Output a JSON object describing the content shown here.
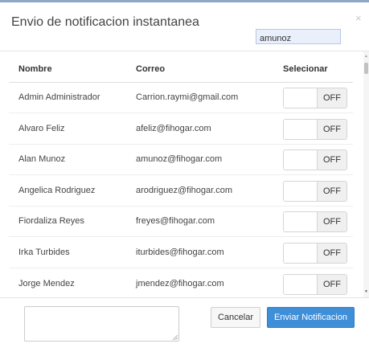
{
  "modal": {
    "title": "Envio de notificacion instantanea",
    "close_glyph": "×"
  },
  "search": {
    "value": "amunoz",
    "placeholder": ""
  },
  "table": {
    "headers": {
      "name": "Nombre",
      "email": "Correo",
      "select": "Selecionar"
    },
    "rows": [
      {
        "name": "Admin Administrador",
        "email": "Carrion.raymi@gmail.com",
        "toggle": "OFF"
      },
      {
        "name": "Alvaro Feliz",
        "email": "afeliz@fihogar.com",
        "toggle": "OFF"
      },
      {
        "name": "Alan Munoz",
        "email": "amunoz@fihogar.com",
        "toggle": "OFF"
      },
      {
        "name": "Angelica Rodriguez",
        "email": "arodriguez@fihogar.com",
        "toggle": "OFF"
      },
      {
        "name": "Fiordaliza Reyes",
        "email": "freyes@fihogar.com",
        "toggle": "OFF"
      },
      {
        "name": "Irka Turbides",
        "email": "iturbides@fihogar.com",
        "toggle": "OFF"
      },
      {
        "name": "Jorge Mendez",
        "email": "jmendez@fihogar.com",
        "toggle": "OFF"
      }
    ]
  },
  "scrollbar": {
    "up_glyph": "▲",
    "down_glyph": "▼"
  },
  "footer": {
    "message_value": "",
    "cancel_label": "Cancelar",
    "send_label": "Enviar Notificacion"
  },
  "colors": {
    "primary_button": "#3f8ed8",
    "search_highlight": "#e9effb",
    "top_border": "#8fa8c8"
  }
}
